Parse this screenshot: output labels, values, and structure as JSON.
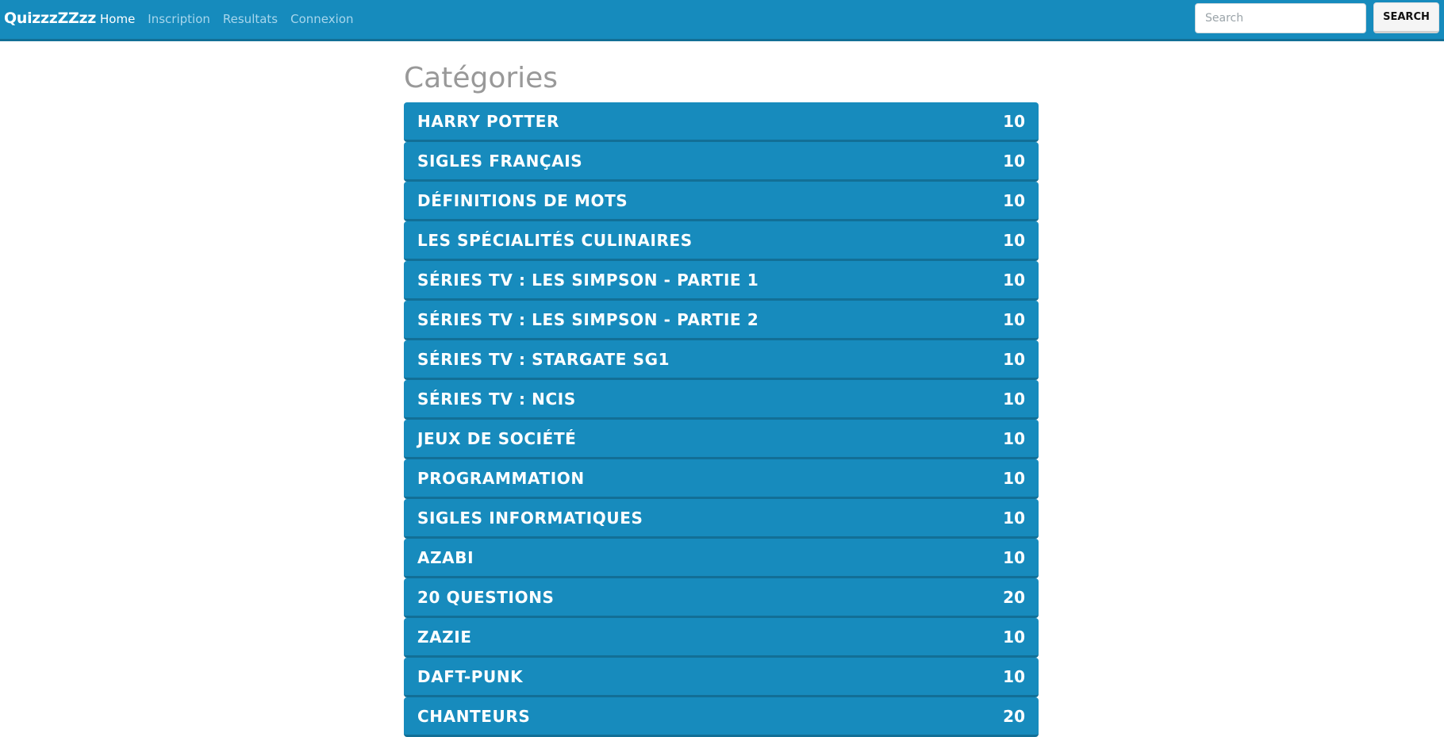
{
  "navbar": {
    "brand": "QuizzzZZzz",
    "links": [
      {
        "label": "Home",
        "active": true
      },
      {
        "label": "Inscription",
        "active": false
      },
      {
        "label": "Resultats",
        "active": false
      },
      {
        "label": "Connexion",
        "active": false
      }
    ],
    "search": {
      "placeholder": "Search",
      "value": "",
      "button_label": "SEARCH"
    }
  },
  "main": {
    "title": "Catégories",
    "categories": [
      {
        "name": "HARRY POTTER",
        "count": "10"
      },
      {
        "name": "SIGLES FRANÇAIS",
        "count": "10"
      },
      {
        "name": "DÉFINITIONS DE MOTS",
        "count": "10"
      },
      {
        "name": "LES SPÉCIALITÉS CULINAIRES",
        "count": "10"
      },
      {
        "name": "SÉRIES TV : LES SIMPSON - PARTIE 1",
        "count": "10"
      },
      {
        "name": "SÉRIES TV : LES SIMPSON - PARTIE 2",
        "count": "10"
      },
      {
        "name": "SÉRIES TV : STARGATE SG1",
        "count": "10"
      },
      {
        "name": "SÉRIES TV : NCIS",
        "count": "10"
      },
      {
        "name": "JEUX DE SOCIÉTÉ",
        "count": "10"
      },
      {
        "name": "PROGRAMMATION",
        "count": "10"
      },
      {
        "name": "SIGLES INFORMATIQUES",
        "count": "10"
      },
      {
        "name": "AZABI",
        "count": "10"
      },
      {
        "name": "20 QUESTIONS",
        "count": "20"
      },
      {
        "name": "ZAZIE",
        "count": "10"
      },
      {
        "name": "DAFT-PUNK",
        "count": "10"
      },
      {
        "name": "CHANTEURS",
        "count": "20"
      }
    ]
  },
  "colors": {
    "navbar_bg": "#168bbd",
    "item_bg": "#178bbd",
    "item_border": "#126f96",
    "title_color": "#999999",
    "nav_link": "#a7d6ec",
    "nav_link_active": "#ffffff"
  }
}
